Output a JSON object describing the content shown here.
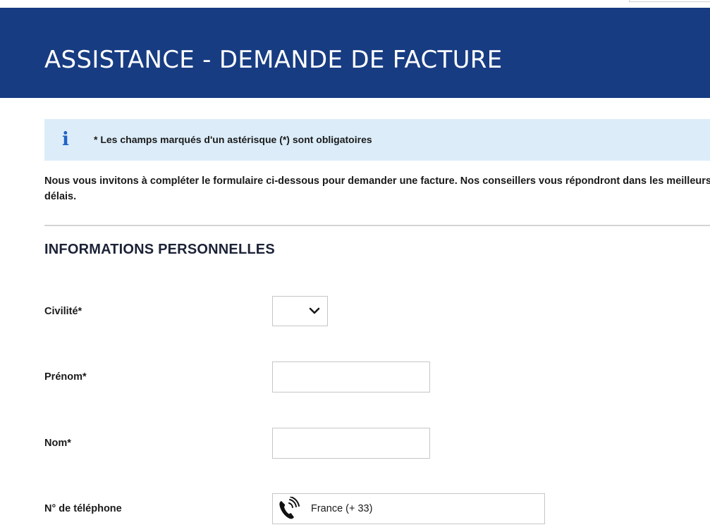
{
  "header": {
    "title": "ASSISTANCE - DEMANDE DE FACTURE"
  },
  "notice": {
    "icon": "info-icon",
    "icon_glyph": "i",
    "text": "* Les champs marqués d'un astérisque (*) sont obligatoires",
    "background_color": "#dcedf9",
    "icon_color": "#1f63c6"
  },
  "intro": {
    "text": "Nous vous invitons à compléter le formulaire ci-dessous pour demander une facture. Nos conseillers vous répondront  dans les meilleurs délais."
  },
  "section": {
    "title": "INFORMATIONS PERSONNELLES"
  },
  "form": {
    "civilite": {
      "label": "Civilité*",
      "value": "",
      "icon": "chevron-down-icon"
    },
    "prenom": {
      "label": "Prénom*",
      "value": ""
    },
    "nom": {
      "label": "Nom*",
      "value": ""
    },
    "telephone": {
      "label": "N° de téléphone",
      "country": "France (+ 33)",
      "icon": "phone-icon"
    }
  },
  "colors": {
    "banner": "#173c82",
    "banner_text": "#ffffff"
  }
}
